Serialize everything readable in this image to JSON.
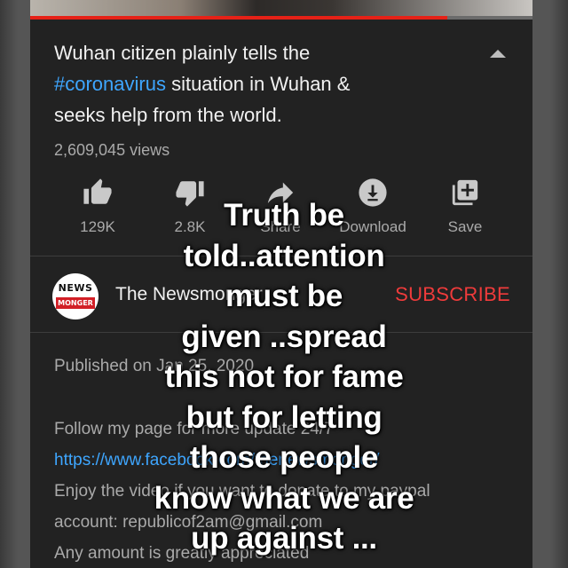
{
  "video": {
    "progress_fraction": 0.83
  },
  "title": {
    "prefix": "Wuhan citizen plainly tells the",
    "hashtag": "#coronavirus",
    "suffix_line2": " situation in Wuhan &",
    "line3": "seeks help from the world."
  },
  "views": "2,609,045 views",
  "actions": {
    "like": {
      "label": "129K",
      "icon": "thumbs-up-icon"
    },
    "dislike": {
      "label": "2.8K",
      "icon": "thumbs-down-icon"
    },
    "share": {
      "label": "Share",
      "icon": "share-icon"
    },
    "download": {
      "label": "Download",
      "icon": "download-icon"
    },
    "save": {
      "label": "Save",
      "icon": "add-to-playlist-icon"
    }
  },
  "channel": {
    "avatar_top": "NEWS",
    "avatar_bottom": "MONGER",
    "name": "The Newsmonger",
    "subscribe_label": "SUBSCRIBE"
  },
  "description": {
    "published": "Published on Jan 25, 2020",
    "follow": "Follow my page for more update 24/7",
    "link": "https://www.facebook.com/thenewsmonger/",
    "enjoy": "Enjoy the video if you want to donate to my paypal",
    "account": "account: republicof2am@gmail.com",
    "amount": "Any amount is greatly appreciated"
  },
  "overlay_text": {
    "lines": [
      "Truth be",
      "told..attention",
      "must be",
      "given ..spread",
      "this not for fame",
      "but for letting",
      "those people",
      "know what we are",
      "up against ..."
    ]
  },
  "colors": {
    "background": "#222222",
    "link": "#3ea6ff",
    "subscribe": "#ef3b3b",
    "progress": "#e62117",
    "muted_text": "#aaaaaa"
  }
}
